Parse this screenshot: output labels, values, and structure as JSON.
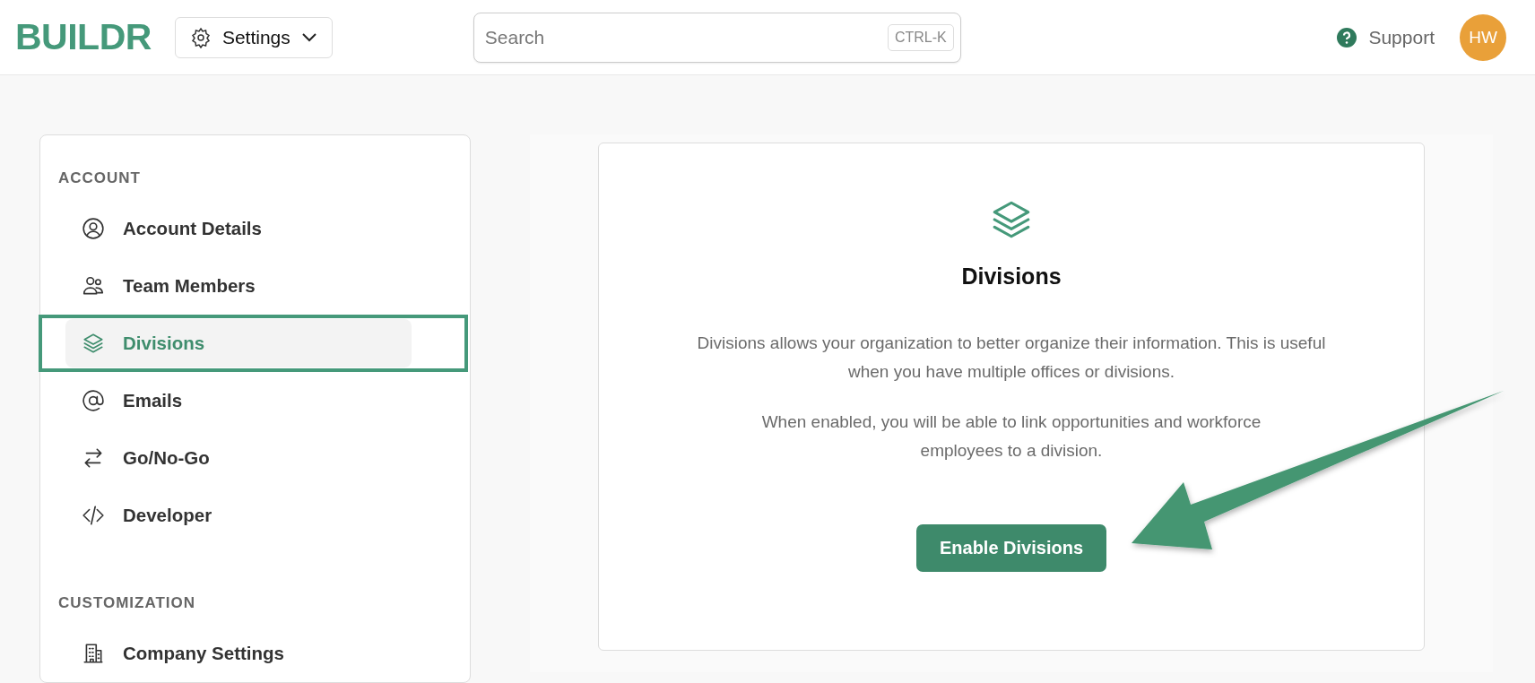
{
  "header": {
    "logo": "BUILDR",
    "menu": {
      "label": "Settings"
    },
    "search": {
      "placeholder": "Search",
      "shortcut": "CTRL-K"
    },
    "support": "Support",
    "avatar": "HW"
  },
  "sidebar": {
    "sections": [
      {
        "title": "ACCOUNT",
        "items": [
          {
            "label": "Account Details",
            "kind": "user",
            "selected": false
          },
          {
            "label": "Team Members",
            "kind": "users",
            "selected": false
          },
          {
            "label": "Divisions",
            "kind": "layers",
            "selected": true
          },
          {
            "label": "Emails",
            "kind": "at",
            "selected": false
          },
          {
            "label": "Go/No-Go",
            "kind": "swap",
            "selected": false
          },
          {
            "label": "Developer",
            "kind": "code",
            "selected": false
          }
        ]
      },
      {
        "title": "CUSTOMIZATION",
        "items": [
          {
            "label": "Company Settings",
            "kind": "building",
            "selected": false
          }
        ]
      }
    ]
  },
  "card": {
    "title": "Divisions",
    "paragraphs": [
      "Divisions allows your organization to better organize their information. This is useful when you have multiple offices or divisions.",
      "When enabled, you will be able to link opportunities and workforce employees to a division."
    ],
    "button": "Enable Divisions"
  }
}
